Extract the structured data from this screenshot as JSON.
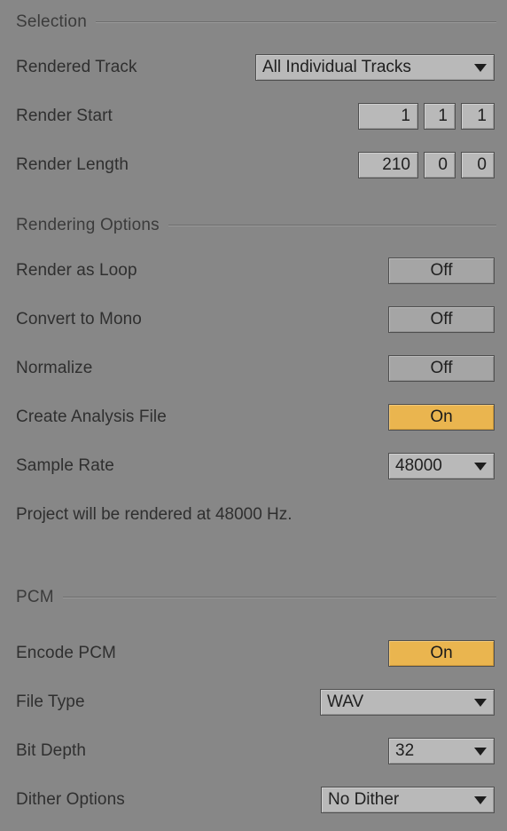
{
  "colors": {
    "background": "#878787",
    "label_text": "#2f2f2f",
    "control_face": "#b9b9b9",
    "control_border": "#4f4f4f",
    "toggle_on": "#eab54f",
    "toggle_off": "#a5a5a5",
    "rule": "#6e6e6e"
  },
  "sections": {
    "selection": {
      "title": "Selection",
      "rendered_track": {
        "label": "Rendered Track",
        "value": "All Individual Tracks",
        "caret": "chevron-down-icon"
      },
      "render_start": {
        "label": "Render Start",
        "bars": "1",
        "beats": "1",
        "sixteenths": "1"
      },
      "render_length": {
        "label": "Render Length",
        "bars": "210",
        "beats": "0",
        "sixteenths": "0"
      }
    },
    "rendering_options": {
      "title": "Rendering Options",
      "render_as_loop": {
        "label": "Render as Loop",
        "value": "Off",
        "state": "off"
      },
      "convert_to_mono": {
        "label": "Convert to Mono",
        "value": "Off",
        "state": "off"
      },
      "normalize": {
        "label": "Normalize",
        "value": "Off",
        "state": "off"
      },
      "create_analysis_file": {
        "label": "Create Analysis File",
        "value": "On",
        "state": "on"
      },
      "sample_rate": {
        "label": "Sample Rate",
        "value": "48000",
        "caret": "chevron-down-icon"
      },
      "info": "Project will be rendered at 48000 Hz."
    },
    "pcm": {
      "title": "PCM",
      "encode_pcm": {
        "label": "Encode PCM",
        "value": "On",
        "state": "on"
      },
      "file_type": {
        "label": "File Type",
        "value": "WAV",
        "caret": "chevron-down-icon"
      },
      "bit_depth": {
        "label": "Bit Depth",
        "value": "32",
        "caret": "chevron-down-icon"
      },
      "dither_options": {
        "label": "Dither Options",
        "value": "No Dither",
        "caret": "chevron-down-icon"
      }
    }
  }
}
